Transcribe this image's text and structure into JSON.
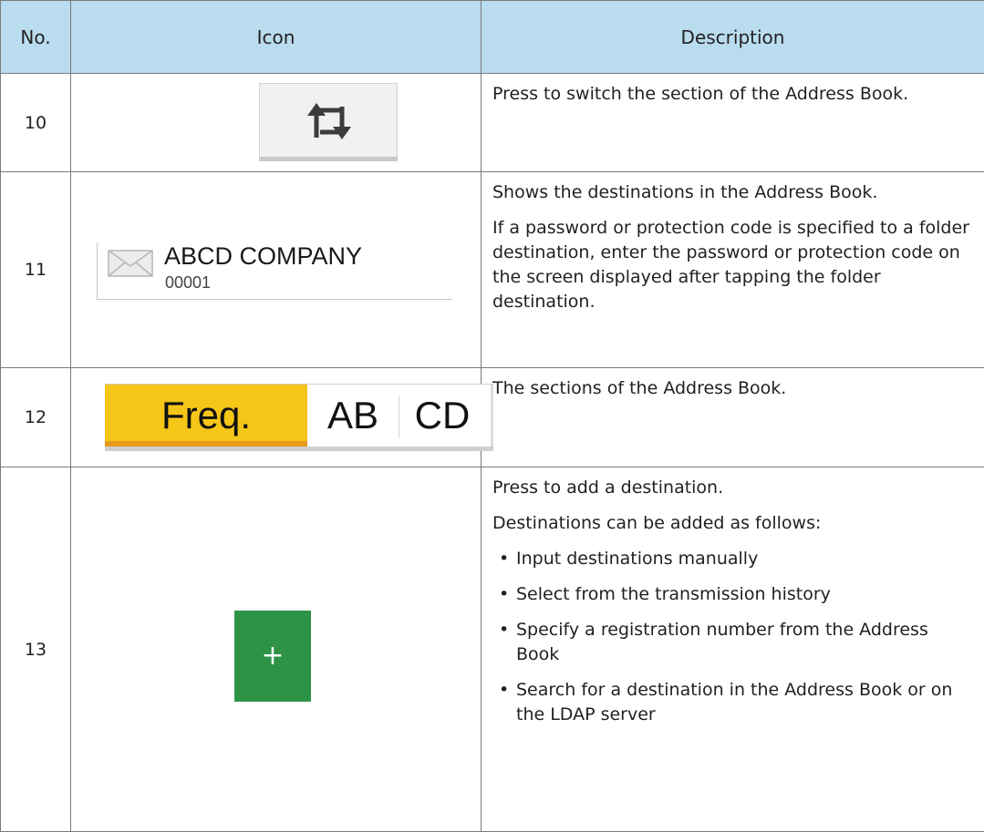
{
  "header": {
    "no": "No.",
    "icon": "Icon",
    "description": "Description"
  },
  "rows": [
    {
      "no": "10",
      "icon": "switch-section-icon",
      "description": [
        "Press to switch the section of the Address Book."
      ]
    },
    {
      "no": "11",
      "icon": "address-entry",
      "entry": {
        "name": "ABCD COMPANY",
        "number": "00001",
        "icon": "envelope-icon"
      },
      "description": [
        "Shows the destinations in the Address Book.",
        "If a password or protection code is specified to a folder destination, enter the password or protection code on the screen displayed after tapping the folder destination."
      ]
    },
    {
      "no": "12",
      "icon": "section-tabs",
      "tabs": [
        {
          "label": "Freq.",
          "selected": true
        },
        {
          "label": "AB",
          "selected": false
        },
        {
          "label": "CD",
          "selected": false
        }
      ],
      "description": [
        "The sections of the Address Book."
      ]
    },
    {
      "no": "13",
      "icon": "add-destination",
      "button_label": "+",
      "description": [
        "Press to add a destination.",
        "Destinations can be added as follows:"
      ],
      "bullets": [
        "Input destinations manually",
        "Select from the transmission history",
        "Specify a registration number from the Address Book",
        "Search for a destination in the Address Book or on the LDAP server"
      ]
    }
  ],
  "colors": {
    "header_bg": "#b9dcef",
    "selected_tab": "#f5c518",
    "add_button": "#2e9247"
  }
}
